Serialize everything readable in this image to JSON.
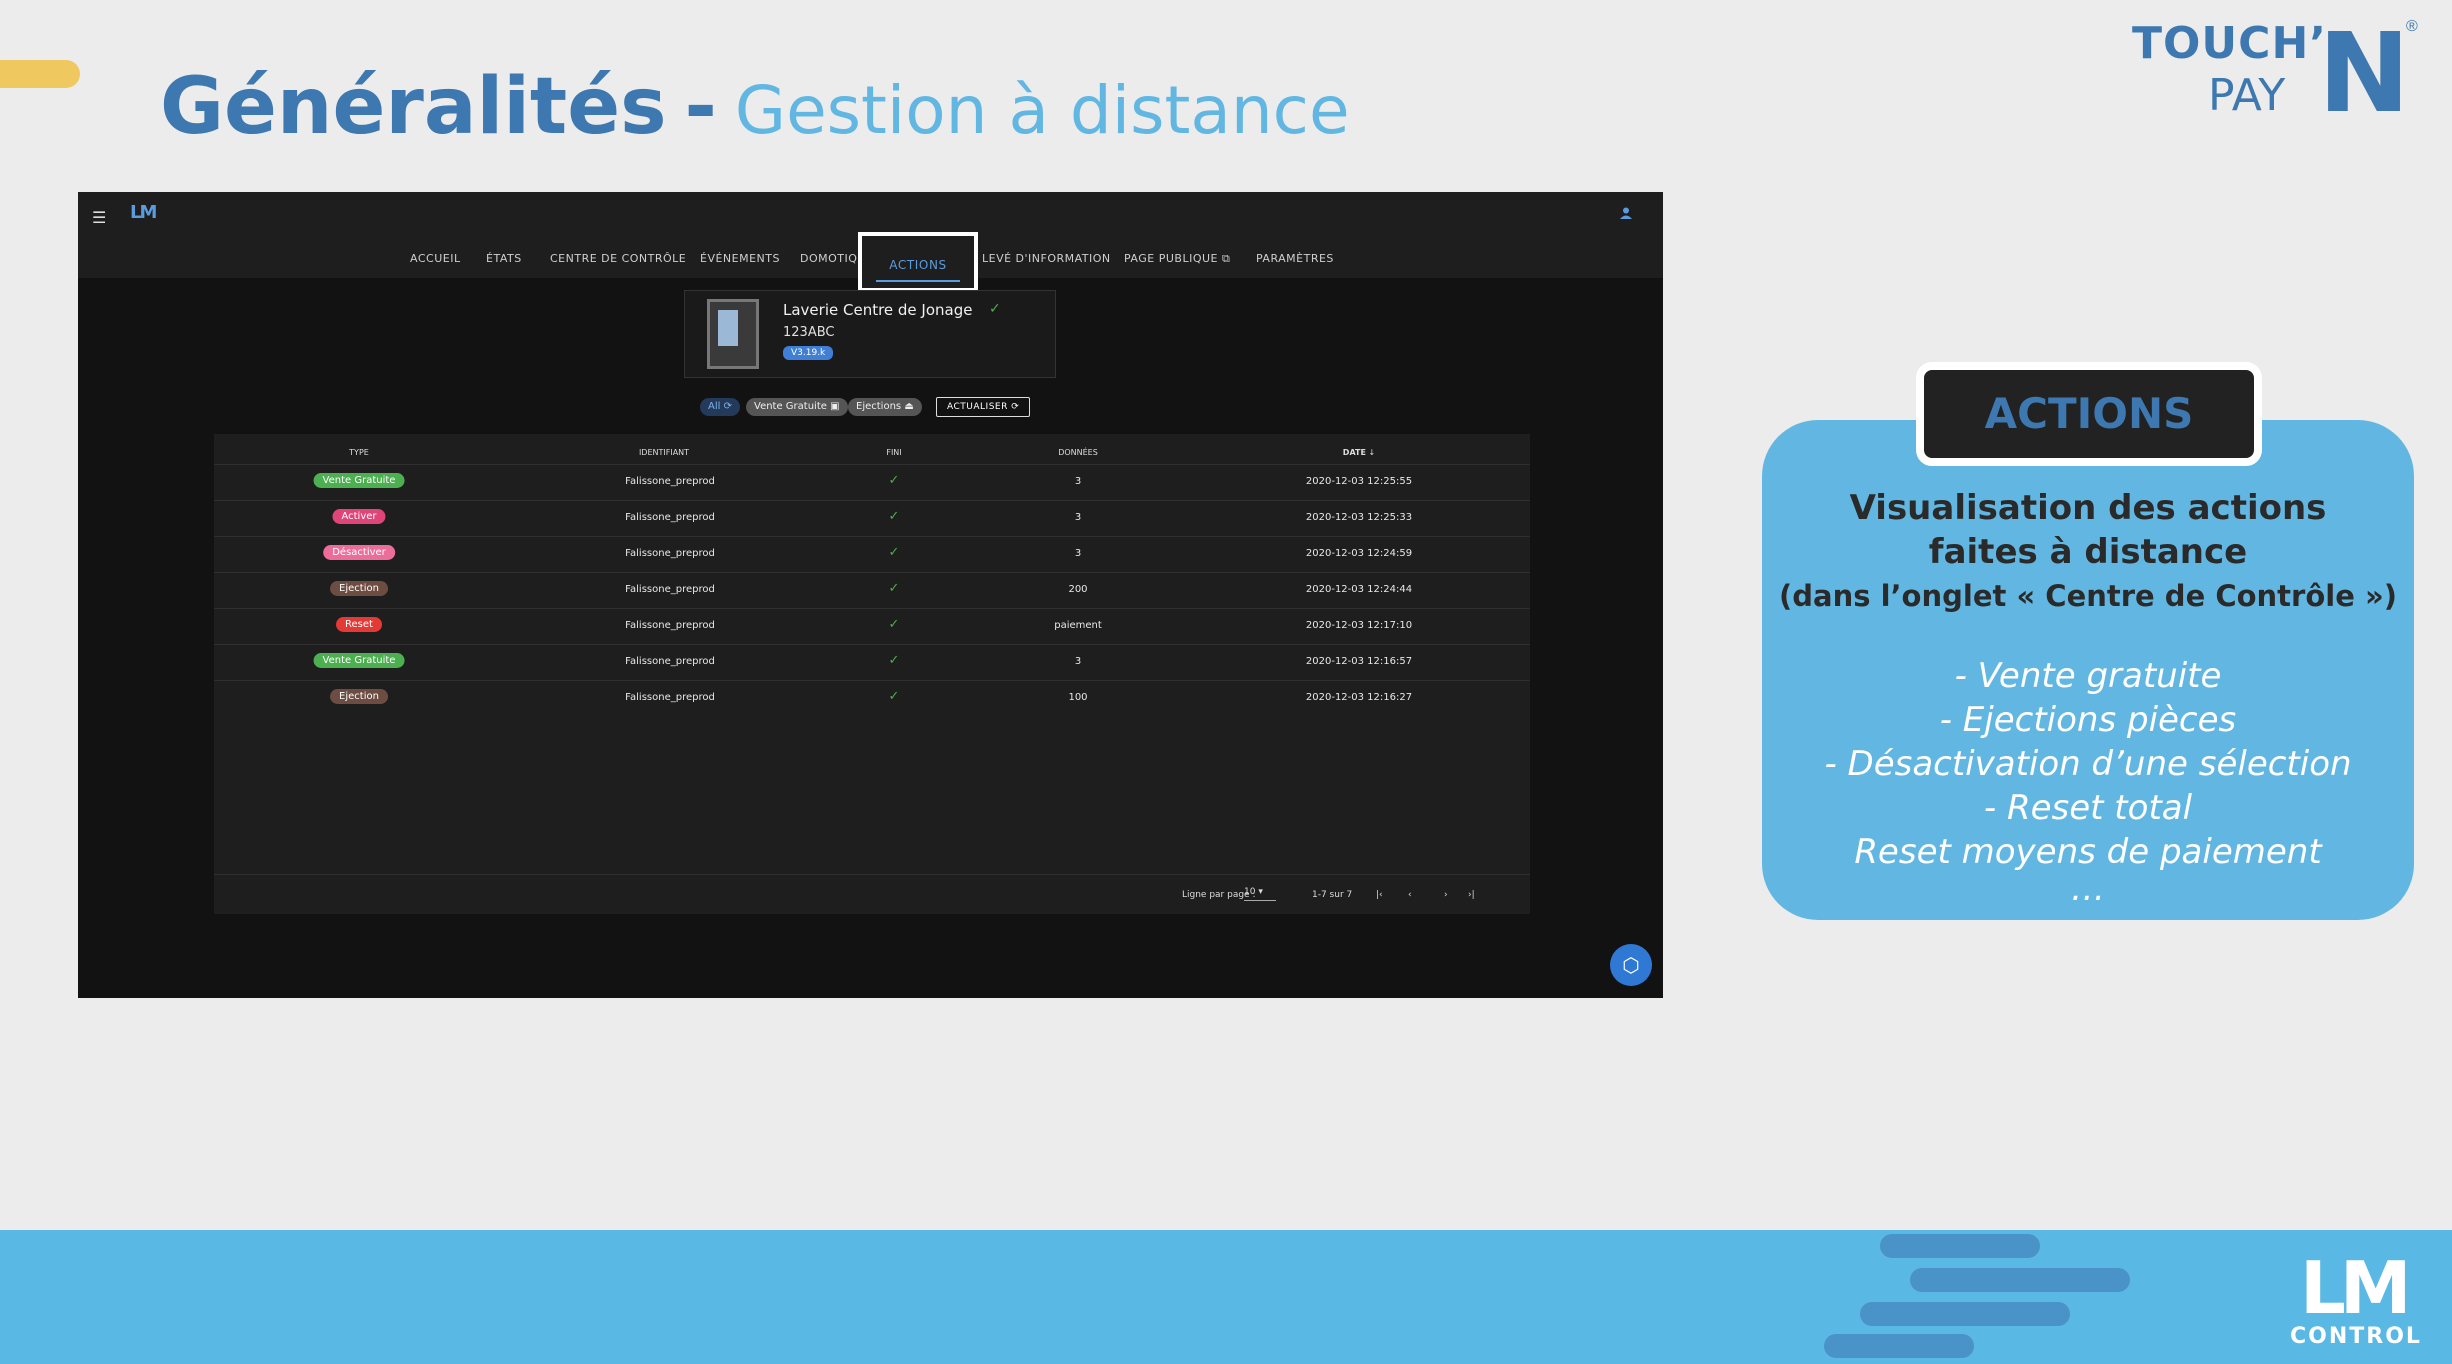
{
  "slide": {
    "title_main": "Généralités",
    "title_dash": "-",
    "title_sub": "Gestion à distance",
    "brand_touch": "TOUCH’",
    "brand_pay": "PAY",
    "brand_n": "N",
    "brand_reg": "®"
  },
  "app": {
    "logo": "LM",
    "nav": [
      "ACCUEIL",
      "ÉTATS",
      "CENTRE DE CONTRÔLE",
      "ÉVÉNEMENTS",
      "DOMOTIQU",
      "ACTIONS",
      "LEVÉ D'INFORMATION",
      "PAGE PUBLIQUE",
      "PARAMÈTRES"
    ],
    "machine": {
      "name": "Laverie Centre de Jonage",
      "code": "123ABC",
      "badge": "V3.19.k"
    },
    "filters": [
      "All",
      "Vente Gratuite",
      "Ejections"
    ],
    "refresh_label": "ACTUALISER",
    "columns": [
      "TYPE",
      "IDENTIFIANT",
      "FINI",
      "DONNÉES",
      "DATE"
    ],
    "rows": [
      {
        "type": "Vente Gratuite",
        "color": "#4caf50",
        "id": "Falissone_preprod",
        "data": "3",
        "date": "2020-12-03 12:25:55"
      },
      {
        "type": "Activer",
        "color": "#e0457a",
        "id": "Falissone_preprod",
        "data": "3",
        "date": "2020-12-03 12:25:33"
      },
      {
        "type": "Désactiver",
        "color": "#ec6d9a",
        "id": "Falissone_preprod",
        "data": "3",
        "date": "2020-12-03 12:24:59"
      },
      {
        "type": "Ejection",
        "color": "#6d4c41",
        "id": "Falissone_preprod",
        "data": "200",
        "date": "2020-12-03 12:24:44"
      },
      {
        "type": "Reset",
        "color": "#e53935",
        "id": "Falissone_preprod",
        "data": "paiement",
        "date": "2020-12-03 12:17:10"
      },
      {
        "type": "Vente Gratuite",
        "color": "#4caf50",
        "id": "Falissone_preprod",
        "data": "3",
        "date": "2020-12-03 12:16:57"
      },
      {
        "type": "Ejection",
        "color": "#6d4c41",
        "id": "Falissone_preprod",
        "data": "100",
        "date": "2020-12-03 12:16:27"
      }
    ],
    "pager": {
      "rows_label": "Ligne par page :",
      "rows_value": "10",
      "range": "1-7 sur 7"
    }
  },
  "card": {
    "tab": "ACTIONS",
    "heading1": "Visualisation des actions",
    "heading2": "faites à distance",
    "sub": "(dans l’onglet « Centre de Contrôle »)",
    "items": [
      "- Vente gratuite",
      "- Ejections pièces",
      "- Désactivation d’une sélection",
      "- Reset total",
      "Reset moyens de paiement",
      "…"
    ]
  },
  "footer": {
    "logo_lm": "LM",
    "logo_control": "CONTROL"
  }
}
